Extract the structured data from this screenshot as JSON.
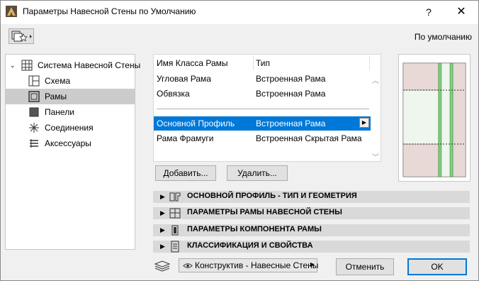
{
  "window": {
    "title": "Параметры Навесной Стены по Умолчанию",
    "help": "?",
    "close": "✕"
  },
  "favorites_label": "По умолчанию",
  "tree": {
    "root": "Система Навесной Стены",
    "items": [
      {
        "label": "Схема",
        "icon": "scheme-icon"
      },
      {
        "label": "Рамы",
        "icon": "frame-icon",
        "selected": true
      },
      {
        "label": "Панели",
        "icon": "panel-icon"
      },
      {
        "label": "Соединения",
        "icon": "junction-icon"
      },
      {
        "label": "Аксессуары",
        "icon": "accessory-icon"
      }
    ]
  },
  "frame_list": {
    "col1": "Имя Класса Рамы",
    "col2": "Тип",
    "rows": [
      {
        "name": "Угловая Рама",
        "type": "Встроенная Рама"
      },
      {
        "name": "Обвязка",
        "type": "Встроенная Рама"
      },
      {
        "name": "Основной Профиль",
        "type": "Встроенная Рама",
        "selected": true
      },
      {
        "name": "Рама Фрамуги",
        "type": "Встроенная Скрытая Рама"
      }
    ]
  },
  "buttons": {
    "add": "Добавить...",
    "delete": "Удалить...",
    "cancel": "Отменить",
    "ok": "OK"
  },
  "sections": [
    "ОСНОВНОЙ ПРОФИЛЬ - ТИП И ГЕОМЕТРИЯ",
    "ПАРАМЕТРЫ РАМЫ НАВЕСНОЙ СТЕНЫ",
    "ПАРАМЕТРЫ КОМПОНЕНТА РАМЫ",
    "КЛАССИФИКАЦИЯ И СВОЙСТВА"
  ],
  "layer_dropdown": "Конструктив - Навесные Стены",
  "colors": {
    "selection": "#0078d7",
    "tree_selection": "#cccccc",
    "preview_panel": "#e8d8d6",
    "preview_frame": "#7fd17f"
  }
}
